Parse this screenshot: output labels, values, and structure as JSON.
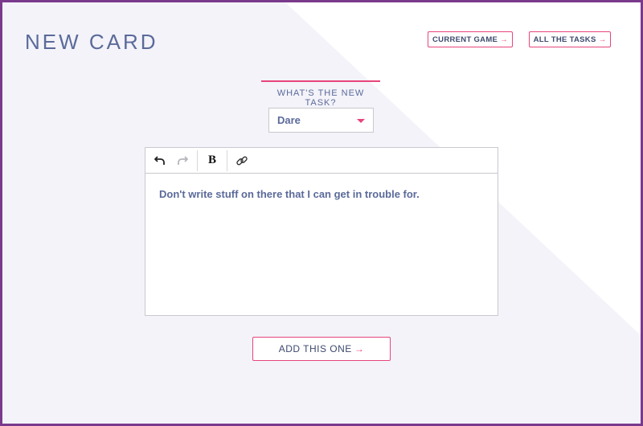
{
  "header": {
    "title": "NEW CARD",
    "nav": [
      {
        "label": "CURRENT GAME",
        "arrow": "→"
      },
      {
        "label": "ALL THE TASKS",
        "arrow": "→"
      }
    ]
  },
  "form": {
    "prompt": "WHAT'S THE NEW TASK?",
    "task_type": {
      "selected": "Dare"
    },
    "editor": {
      "toolbar": [
        "undo-icon",
        "redo-icon",
        "bold-icon",
        "link-icon"
      ],
      "bold_glyph": "B",
      "content": "Don't write stuff on there that I can get in trouble for."
    },
    "submit": {
      "label": "ADD THIS ONE",
      "arrow": "→"
    }
  },
  "colors": {
    "accent": "#e8457a",
    "text": "#5b6a9a",
    "frame": "#7a3a8c",
    "panel": "#f3f3f9"
  }
}
